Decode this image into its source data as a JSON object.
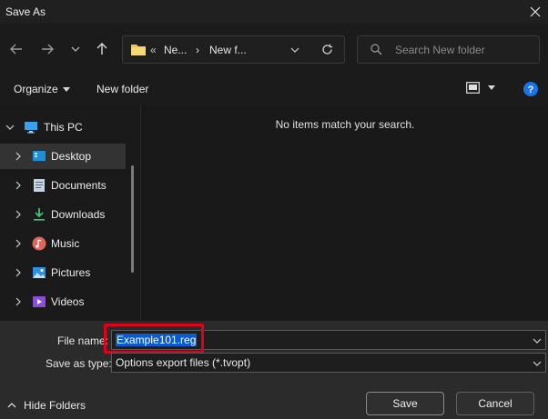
{
  "window": {
    "title": "Save As"
  },
  "address": {
    "crumb1": "Ne...",
    "crumb2": "New f..."
  },
  "search": {
    "placeholder": "Search New folder"
  },
  "toolbar": {
    "organize_label": "Organize",
    "new_folder_label": "New folder"
  },
  "nav": {
    "items": [
      {
        "label": "This PC",
        "icon": "monitor-icon"
      },
      {
        "label": "Desktop",
        "icon": "desktop-icon"
      },
      {
        "label": "Documents",
        "icon": "document-icon"
      },
      {
        "label": "Downloads",
        "icon": "download-icon"
      },
      {
        "label": "Music",
        "icon": "music-icon"
      },
      {
        "label": "Pictures",
        "icon": "picture-icon"
      },
      {
        "label": "Videos",
        "icon": "video-icon"
      }
    ]
  },
  "content": {
    "empty_message": "No items match your search."
  },
  "form": {
    "file_name_label": "File name:",
    "file_name_value": "Example101.reg",
    "save_type_label": "Save as type:",
    "save_type_value": "Options export files (*.tvopt)"
  },
  "actions": {
    "hide_folders_label": "Hide Folders",
    "save_label": "Save",
    "cancel_label": "Cancel"
  },
  "colors": {
    "highlight_border": "#e0001a",
    "selection": "#0a5ad0",
    "help": "#1a73e8"
  }
}
